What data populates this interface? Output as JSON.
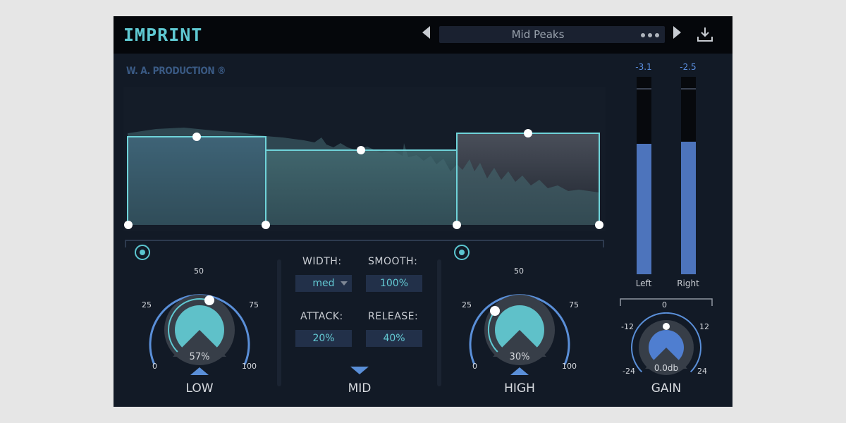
{
  "header": {
    "logo": "IMPRINT",
    "preset_name": "Mid Peaks"
  },
  "brand": "W. A. PRODUCTION ®",
  "bands": {
    "low": {
      "label": "LOW",
      "value_text": "57%",
      "value": 57,
      "scale": [
        "0",
        "25",
        "50",
        "75",
        "100"
      ]
    },
    "mid": {
      "label": "MID",
      "width_label": "WIDTH:",
      "width_value": "med",
      "smooth_label": "SMOOTH:",
      "smooth_value": "100%",
      "attack_label": "ATTACK:",
      "attack_value": "20%",
      "release_label": "RELEASE:",
      "release_value": "40%"
    },
    "high": {
      "label": "HIGH",
      "value_text": "30%",
      "value": 30,
      "scale": [
        "0",
        "25",
        "50",
        "75",
        "100"
      ]
    }
  },
  "gain": {
    "label": "GAIN",
    "value_text": "0.0db",
    "value": 0,
    "scale": [
      "-24",
      "-12",
      "0",
      "12",
      "24"
    ]
  },
  "meters": {
    "left": {
      "label": "Left",
      "readout": "-3.1",
      "level": 0.66
    },
    "right": {
      "label": "Right",
      "readout": "-2.5",
      "level": 0.67
    }
  },
  "colors": {
    "accent": "#5fc9d2",
    "blue": "#5a8fd8",
    "panel": "#121a26",
    "header": "#05070b"
  }
}
